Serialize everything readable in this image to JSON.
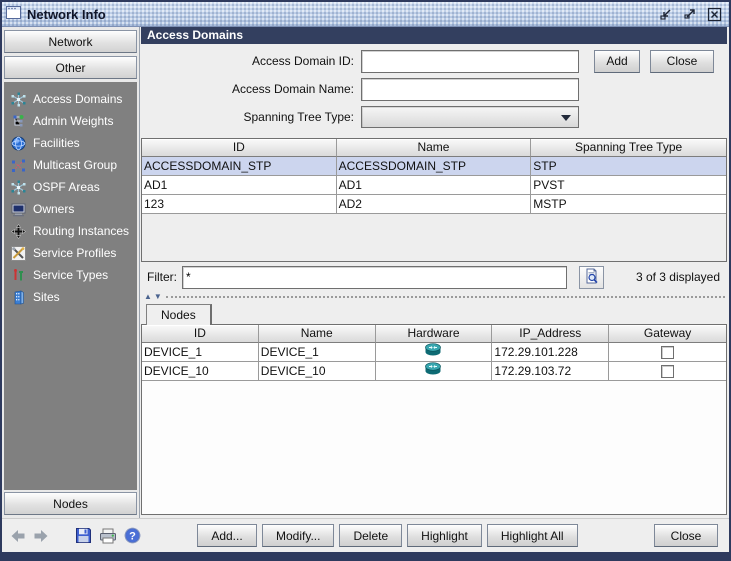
{
  "window": {
    "title": "Network Info"
  },
  "sidebar": {
    "top_buttons": [
      {
        "label": "Network"
      },
      {
        "label": "Other"
      }
    ],
    "items": [
      {
        "label": "Access Domains",
        "icon": "network-star-icon"
      },
      {
        "label": "Admin Weights",
        "icon": "tree-icon"
      },
      {
        "label": "Facilities",
        "icon": "globe-icon"
      },
      {
        "label": "Multicast Group",
        "icon": "multicast-icon"
      },
      {
        "label": "OSPF Areas",
        "icon": "network-star-icon"
      },
      {
        "label": "Owners",
        "icon": "monitor-icon"
      },
      {
        "label": "Routing Instances",
        "icon": "cross-arrows-icon"
      },
      {
        "label": "Service Profiles",
        "icon": "tools-icon"
      },
      {
        "label": "Service Types",
        "icon": "small-tools-icon"
      },
      {
        "label": "Sites",
        "icon": "building-icon"
      }
    ],
    "nodes_button": "Nodes"
  },
  "header": {
    "title": "Access Domains"
  },
  "form": {
    "id_label": "Access Domain ID:",
    "id_value": "",
    "name_label": "Access Domain Name:",
    "name_value": "",
    "stp_label": "Spanning Tree Type:",
    "stp_value": "",
    "add_button": "Add",
    "close_button": "Close"
  },
  "domains_table": {
    "columns": [
      "ID",
      "Name",
      "Spanning Tree Type"
    ],
    "rows": [
      {
        "id": "ACCESSDOMAIN_STP",
        "name": "ACCESSDOMAIN_STP",
        "type": "STP",
        "selected": true
      },
      {
        "id": "AD1",
        "name": "AD1",
        "type": "PVST",
        "selected": false
      },
      {
        "id": "123",
        "name": "AD2",
        "type": "MSTP",
        "selected": false
      }
    ]
  },
  "filter": {
    "label": "Filter:",
    "value": "*",
    "status": "3 of 3 displayed"
  },
  "nodes_tab": {
    "label": "Nodes",
    "columns": [
      "ID",
      "Name",
      "Hardware",
      "IP_Address",
      "Gateway"
    ],
    "rows": [
      {
        "id": "DEVICE_1",
        "name": "DEVICE_1",
        "hardware": "router-icon",
        "ip": "172.29.101.228",
        "gateway_checked": false
      },
      {
        "id": "DEVICE_10",
        "name": "DEVICE_10",
        "hardware": "router-icon",
        "ip": "172.29.103.72",
        "gateway_checked": false
      }
    ]
  },
  "footer": {
    "buttons": [
      "Add...",
      "Modify...",
      "Delete",
      "Highlight",
      "Highlight All"
    ],
    "close_button": "Close"
  },
  "colors": {
    "titlebar": "#b7c8e2",
    "window_border": "#2e3a5e",
    "section_header_bg": "#333f5f",
    "sidebar_bg": "#808080",
    "selected_row_bg": "#ccd5ee",
    "router_icon": "#1d7f86"
  }
}
